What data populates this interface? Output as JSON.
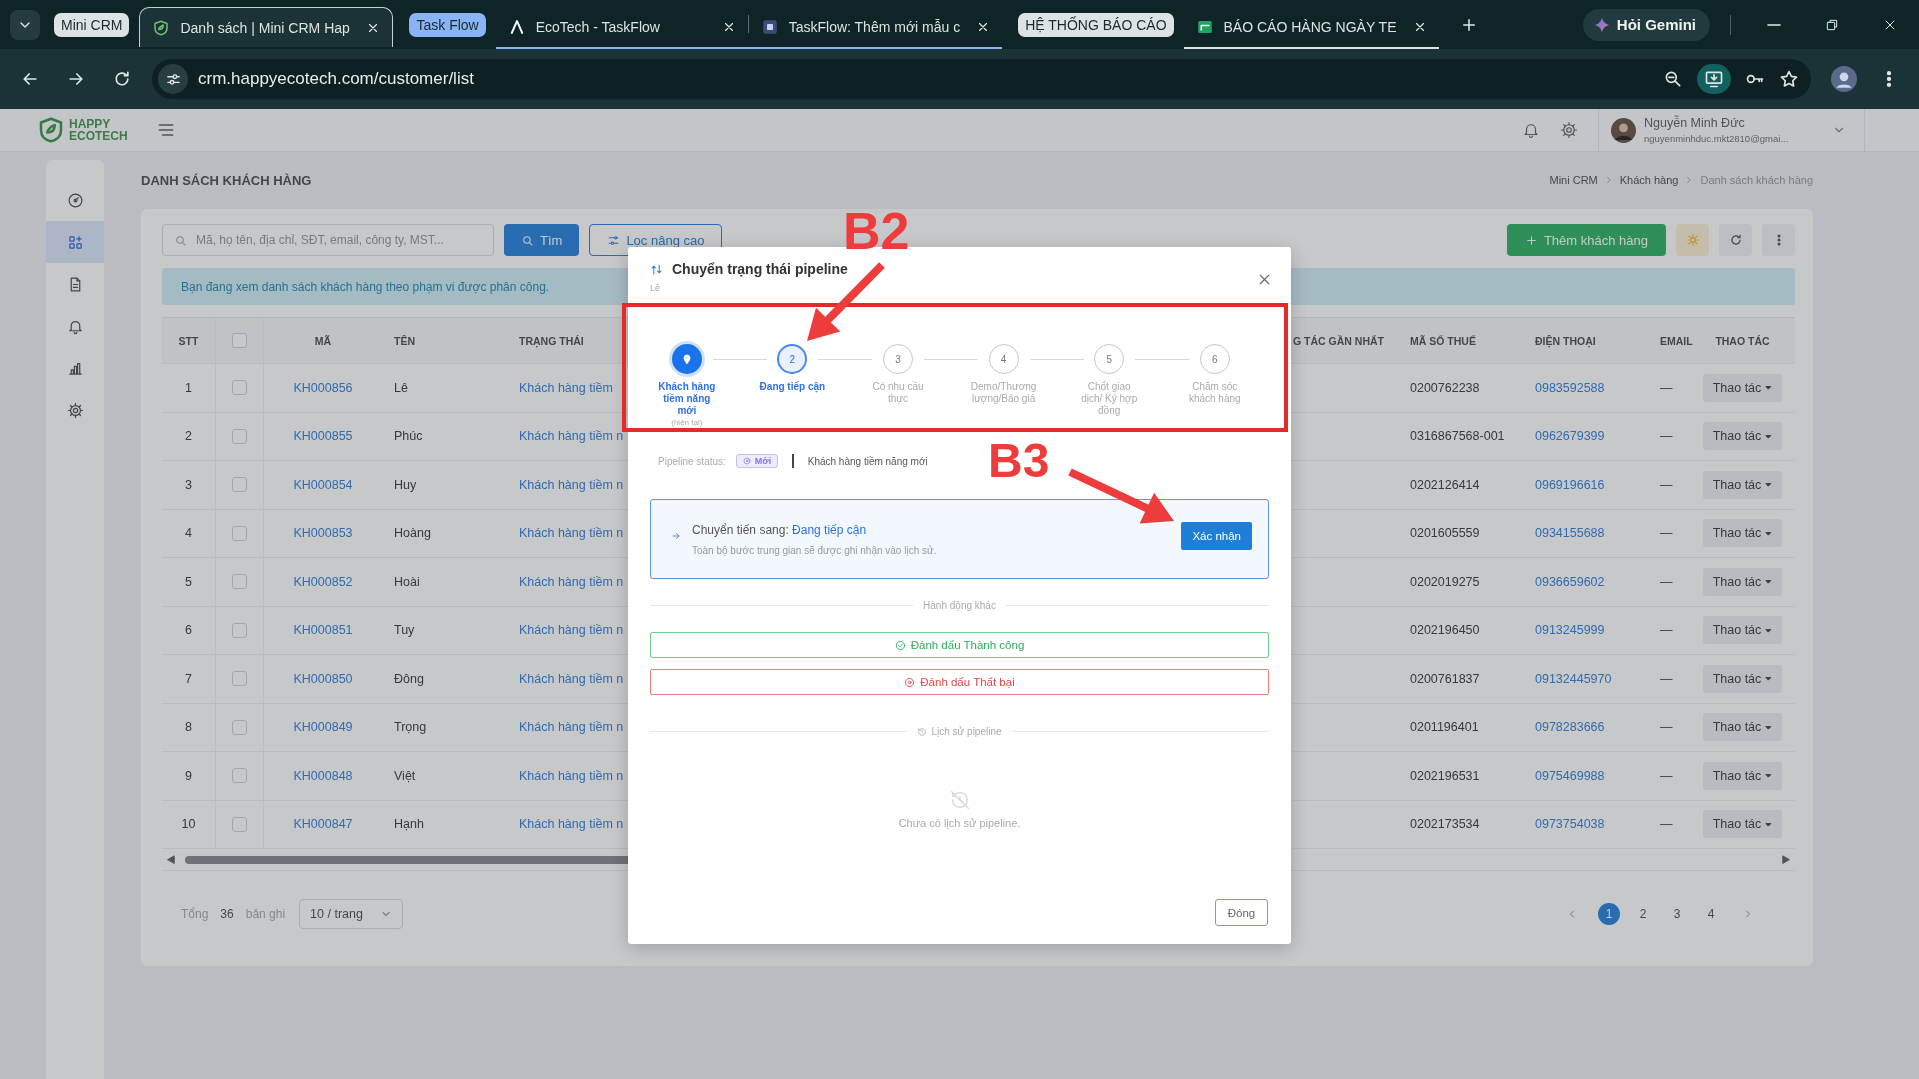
{
  "browser": {
    "tab_groups": [
      {
        "label": "Mini CRM",
        "color": "#dde3e4",
        "tabs": [
          {
            "title": "Danh sách | Mini CRM Hap",
            "selected": true
          }
        ]
      },
      {
        "label": "Task Flow",
        "color": "#8ab4f8",
        "tabs": [
          {
            "title": "EcoTech - TaskFlow",
            "selected": false
          },
          {
            "title": "TaskFlow: Thêm mới mẫu c",
            "selected": false
          }
        ]
      },
      {
        "label": "HỆ THỐNG BÁO CÁO",
        "color": "#dde3e4",
        "tabs": [
          {
            "title": "BÁO CÁO HÀNG NGÀY TE",
            "selected": false
          }
        ]
      }
    ],
    "gemini_button": "Hỏi Gemini",
    "url": "crm.happyecotech.com/customer/list"
  },
  "app": {
    "logo": {
      "line_1": "HAPPY",
      "line_2": "ECOTECH"
    },
    "user": {
      "name": "Nguyễn Minh Đức",
      "email": "nguyenminhduc.mkt2810@gmai..."
    },
    "sidebar": {
      "items": [
        {
          "selected": false
        },
        {
          "selected": true
        },
        {
          "selected": false
        },
        {
          "selected": false
        },
        {
          "selected": false
        },
        {
          "selected": false
        }
      ]
    },
    "page_title": "DANH SÁCH KHÁCH HÀNG",
    "breadcrumb": [
      "Mini CRM",
      "Khách hàng",
      "Danh sách khách hàng"
    ],
    "search": {
      "placeholder": "Mã, họ tên, địa chỉ, SĐT, email, công ty, MST..."
    },
    "search_button": "Tìm",
    "filter_button": "Lọc nâng cao",
    "add_button": "Thêm khách hàng",
    "notice": "Bạn đang xem danh sách khách hàng theo phạm vi được phân công.",
    "table": {
      "columns": [
        {
          "kind": "text",
          "label": "STT"
        },
        {
          "kind": "checkbox",
          "checked": false
        },
        {
          "kind": "text",
          "label": "MÃ"
        },
        {
          "kind": "text",
          "label": "TÊN"
        },
        {
          "kind": "text",
          "label": "TRẠNG THÁI"
        },
        {
          "kind": "text",
          "label": "G TÁC GẦN NHẤT"
        },
        {
          "kind": "text",
          "label": "MÃ SỐ THUẾ"
        },
        {
          "kind": "text",
          "label": "ĐIỆN THOẠI"
        },
        {
          "kind": "text",
          "label": "EMAIL"
        },
        {
          "kind": "text",
          "label": "THAO TÁC"
        }
      ],
      "rows": [
        {
          "stt": "1",
          "checked": false,
          "code": "KH000856",
          "name": "Lê",
          "status": "Khách hàng tiềm",
          "tax_code": "0200762238",
          "phone": "0983592588",
          "email": "—",
          "action": "Thao tác"
        },
        {
          "stt": "2",
          "checked": false,
          "code": "KH000855",
          "name": "Phúc",
          "status": "Khách hàng tiềm n",
          "tax_code": "0316867568-001",
          "phone": "0962679399",
          "email": "—",
          "action": "Thao tác"
        },
        {
          "stt": "3",
          "checked": false,
          "code": "KH000854",
          "name": "Huy",
          "status": "Khách hàng tiềm n",
          "tax_code": "0202126414",
          "phone": "0969196616",
          "email": "—",
          "action": "Thao tác"
        },
        {
          "stt": "4",
          "checked": false,
          "code": "KH000853",
          "name": "Hoàng",
          "status": "Khách hàng tiềm n",
          "tax_code": "0201605559",
          "phone": "0934155688",
          "email": "—",
          "action": "Thao tác"
        },
        {
          "stt": "5",
          "checked": false,
          "code": "KH000852",
          "name": "Hoài",
          "status": "Khách hàng tiềm n",
          "tax_code": "0202019275",
          "phone": "0936659602",
          "email": "—",
          "action": "Thao tác"
        },
        {
          "stt": "6",
          "checked": false,
          "code": "KH000851",
          "name": "Tuy",
          "status": "Khách hàng tiềm n",
          "tax_code": "0202196450",
          "phone": "0913245999",
          "email": "—",
          "action": "Thao tác"
        },
        {
          "stt": "7",
          "checked": false,
          "code": "KH000850",
          "name": "Đông",
          "status": "Khách hàng tiềm n",
          "tax_code": "0200761837",
          "phone": "09132445970",
          "email": "—",
          "action": "Thao tác"
        },
        {
          "stt": "8",
          "checked": false,
          "code": "KH000849",
          "name": "Trọng",
          "status": "Khách hàng tiềm n",
          "tax_code": "0201196401",
          "phone": "0978283666",
          "email": "—",
          "action": "Thao tác"
        },
        {
          "stt": "9",
          "checked": false,
          "code": "KH000848",
          "name": "Việt",
          "status": "Khách hàng tiềm n",
          "tax_code": "0202196531",
          "phone": "0975469988",
          "email": "—",
          "action": "Thao tác"
        },
        {
          "stt": "10",
          "checked": false,
          "code": "KH000847",
          "name": "Hạnh",
          "status": "Khách hàng tiềm n",
          "tax_code": "0202173534",
          "phone": "0973754038",
          "email": "—",
          "action": "Thao tác"
        }
      ]
    },
    "pagination": {
      "total_label": "Tổng",
      "total": "36",
      "unit": "bản ghi",
      "page_size": "10 / trang",
      "pages": [
        {
          "label": "1",
          "selected": true
        },
        {
          "label": "2",
          "selected": false
        },
        {
          "label": "3",
          "selected": false
        },
        {
          "label": "4",
          "selected": false
        }
      ]
    }
  },
  "modal": {
    "title": "Chuyển trạng thái pipeline",
    "subtitle": "Lê",
    "steps": [
      {
        "current": true,
        "selected": false,
        "label": "Khách hàng tiềm năng mới",
        "note": "(hiện tại)"
      },
      {
        "current": false,
        "selected": true,
        "number": "2",
        "label": "Đang tiếp cận"
      },
      {
        "current": false,
        "selected": false,
        "number": "3",
        "label": "Có nhu cầu thực"
      },
      {
        "current": false,
        "selected": false,
        "number": "4",
        "label": "Demo/Thương lượng/Báo giá"
      },
      {
        "current": false,
        "selected": false,
        "number": "5",
        "label": "Chốt giao dịch/ Ký hợp đồng"
      },
      {
        "current": false,
        "selected": false,
        "number": "6",
        "label": "Chăm sóc khách hàng"
      }
    ],
    "status": {
      "label": "Pipeline status:",
      "badge": "Mới",
      "stage": "Khách hàng tiềm năng mới"
    },
    "transition": {
      "prefix": "Chuyển tiến sang:",
      "target": "Đang tiếp cận",
      "note": "Toàn bộ bước trung gian sẽ được ghi nhận vào lịch sử.",
      "confirm": "Xác nhận"
    },
    "other_actions_label": "Hành động khác",
    "actions": [
      {
        "kind": "success",
        "label": "Đánh dấu Thành công"
      },
      {
        "kind": "failure",
        "label": "Đánh dấu Thất bại"
      }
    ],
    "history_label": "Lịch sử pipeline",
    "history_empty": "Chưa có lịch sử pipeline.",
    "close_button": "Đóng"
  },
  "annotations": [
    {
      "text": "B2"
    },
    {
      "text": "B3"
    }
  ]
}
